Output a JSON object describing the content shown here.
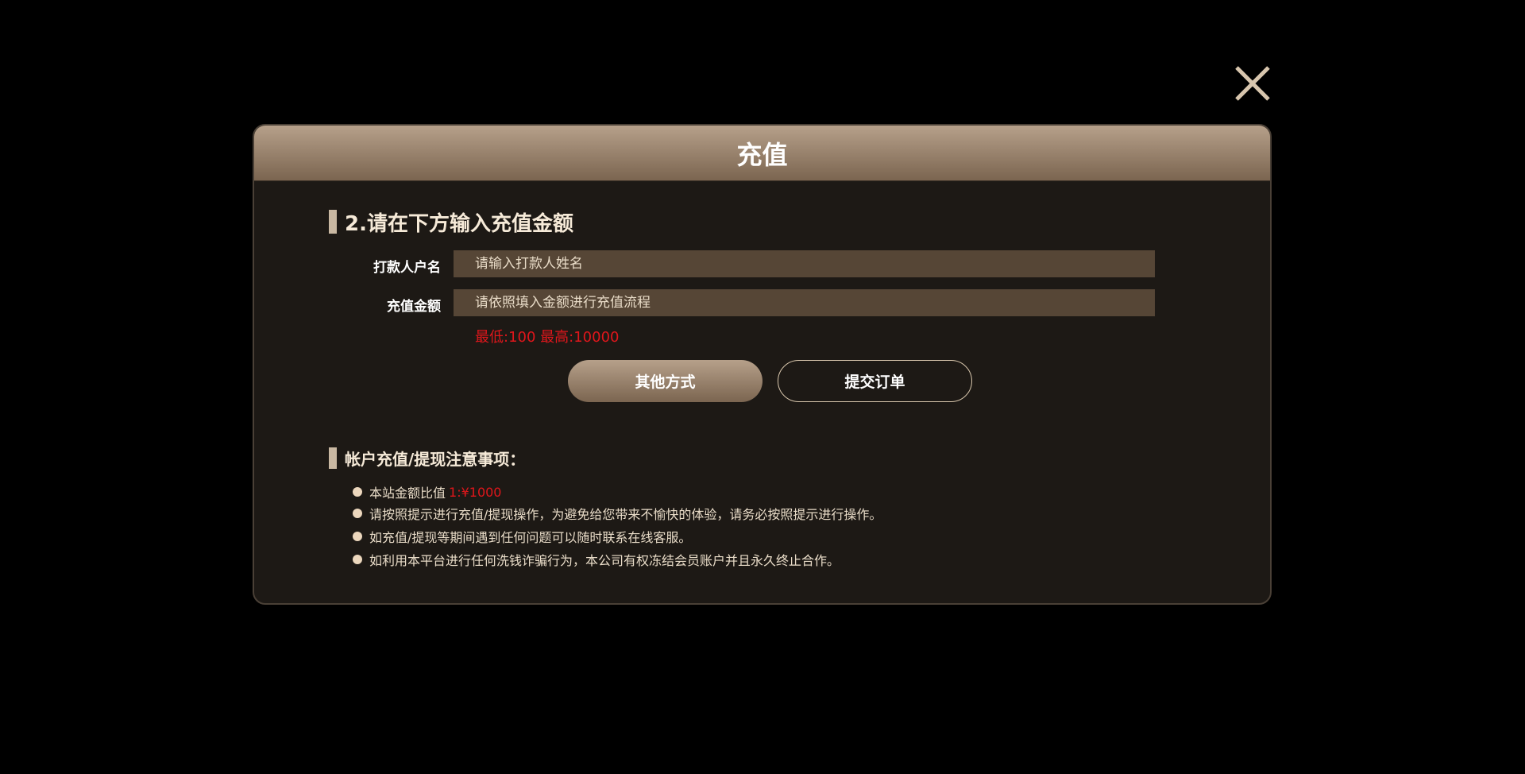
{
  "modal": {
    "title": "充值",
    "close_icon": "close-icon"
  },
  "step": {
    "heading": "2.请在下方输入充值金额"
  },
  "form": {
    "payer_label": "打款人户名",
    "payer_placeholder": "请输入打款人姓名",
    "payer_value": "",
    "amount_label": "充值金额",
    "amount_placeholder": "请依照填入金额进行充值流程",
    "amount_value": "",
    "limits": "最低:100 最高:10000"
  },
  "buttons": {
    "other": "其他方式",
    "submit": "提交订单"
  },
  "notes": {
    "heading": "帐户充值/提现注意事项：",
    "items": [
      {
        "text": "本站金额比值 ",
        "highlight": "1:¥1000"
      },
      {
        "text": "请按照提示进行充值/提现操作，为避免给您带来不愉快的体验，请务必按照提示进行操作。"
      },
      {
        "text": "如充值/提现等期间遇到任何问题可以随时联系在线客服。"
      },
      {
        "text": "如利用本平台进行任何洗钱诈骗行为，本公司有权冻结会员账户并且永久终止合作。"
      }
    ]
  },
  "colors": {
    "accent": "#b6a08a",
    "warning": "#e0161b",
    "background": "#1d1915"
  }
}
